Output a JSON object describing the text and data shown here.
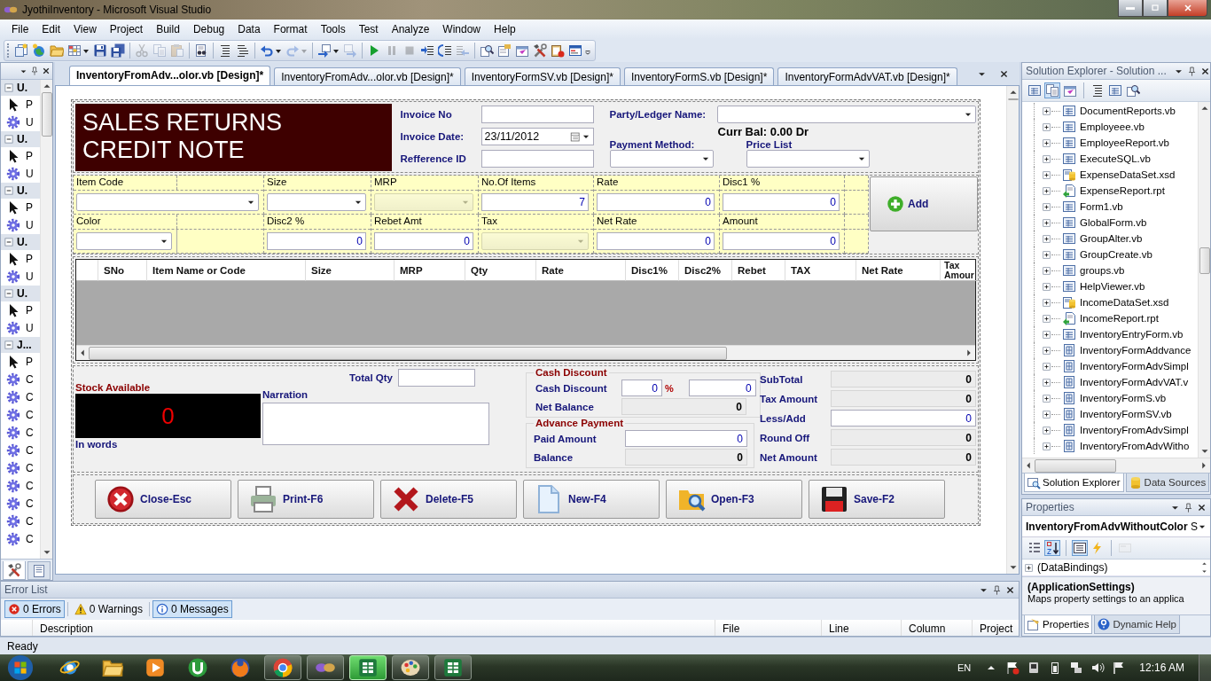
{
  "window": {
    "title": "JyothiInventory - Microsoft Visual Studio"
  },
  "menu": [
    "File",
    "Edit",
    "View",
    "Project",
    "Build",
    "Debug",
    "Data",
    "Format",
    "Tools",
    "Test",
    "Analyze",
    "Window",
    "Help"
  ],
  "toolbar": {
    "groups": [
      [
        {
          "kind": "new-project",
          "disabled": false,
          "dropdown": false
        },
        {
          "kind": "add-web",
          "disabled": false,
          "dropdown": false
        },
        {
          "kind": "open",
          "disabled": false,
          "dropdown": false
        },
        {
          "kind": "add-item",
          "disabled": false,
          "dropdown": true
        },
        {
          "kind": "save",
          "disabled": false,
          "dropdown": false
        },
        {
          "kind": "save-all",
          "disabled": false,
          "dropdown": false
        }
      ],
      [
        {
          "kind": "cut",
          "disabled": true,
          "dropdown": false
        },
        {
          "kind": "copy",
          "disabled": true,
          "dropdown": false
        },
        {
          "kind": "paste",
          "disabled": true,
          "dropdown": false
        }
      ],
      [
        {
          "kind": "find",
          "disabled": false,
          "dropdown": false
        }
      ],
      [
        {
          "kind": "comment",
          "disabled": false,
          "dropdown": false
        },
        {
          "kind": "uncomment",
          "disabled": false,
          "dropdown": false
        }
      ],
      [
        {
          "kind": "undo",
          "disabled": false,
          "dropdown": true
        },
        {
          "kind": "redo",
          "disabled": true,
          "dropdown": true
        }
      ],
      [
        {
          "kind": "navigate-back",
          "disabled": false,
          "dropdown": true
        },
        {
          "kind": "navigate-forward",
          "disabled": true,
          "dropdown": false
        }
      ],
      [
        {
          "kind": "start",
          "disabled": false,
          "dropdown": false
        },
        {
          "kind": "pause",
          "disabled": true,
          "dropdown": false
        },
        {
          "kind": "stop",
          "disabled": true,
          "dropdown": false
        },
        {
          "kind": "step-into",
          "disabled": false,
          "dropdown": false
        },
        {
          "kind": "step-over",
          "disabled": false,
          "dropdown": false
        },
        {
          "kind": "step-out",
          "disabled": true,
          "dropdown": false
        }
      ],
      [
        {
          "kind": "find-in-files",
          "disabled": false,
          "dropdown": false
        },
        {
          "kind": "properties",
          "disabled": false,
          "dropdown": false
        },
        {
          "kind": "object-browser",
          "disabled": false,
          "dropdown": false
        },
        {
          "kind": "toolbox",
          "disabled": false,
          "dropdown": false
        },
        {
          "kind": "error-list",
          "disabled": false,
          "dropdown": false
        },
        {
          "kind": "output",
          "disabled": false,
          "dropdown": false
        }
      ]
    ]
  },
  "toolbox": {
    "groups": [
      {
        "title": "U.",
        "expanded": true,
        "items": [
          {
            "kind": "pointer",
            "label": "P"
          },
          {
            "kind": "component",
            "label": "U"
          }
        ]
      },
      {
        "title": "U.",
        "expanded": true,
        "items": [
          {
            "kind": "pointer",
            "label": "P"
          },
          {
            "kind": "component",
            "label": "U"
          }
        ]
      },
      {
        "title": "U.",
        "expanded": true,
        "items": [
          {
            "kind": "pointer",
            "label": "P"
          },
          {
            "kind": "component",
            "label": "U"
          }
        ]
      },
      {
        "title": "U.",
        "expanded": true,
        "items": [
          {
            "kind": "pointer",
            "label": "P"
          },
          {
            "kind": "component",
            "label": "U"
          }
        ]
      },
      {
        "title": "U.",
        "expanded": true,
        "items": [
          {
            "kind": "pointer",
            "label": "P"
          },
          {
            "kind": "component",
            "label": "U"
          }
        ]
      },
      {
        "title": "J...",
        "expanded": true,
        "items": [
          {
            "kind": "pointer",
            "label": "P"
          },
          {
            "kind": "component",
            "label": "C"
          },
          {
            "kind": "component",
            "label": "C"
          },
          {
            "kind": "component",
            "label": "C"
          },
          {
            "kind": "component",
            "label": "C"
          },
          {
            "kind": "component",
            "label": "C"
          },
          {
            "kind": "component",
            "label": "C"
          },
          {
            "kind": "component",
            "label": "C"
          },
          {
            "kind": "component",
            "label": "C"
          },
          {
            "kind": "component",
            "label": "C"
          },
          {
            "kind": "component",
            "label": "C"
          }
        ]
      }
    ],
    "tabs": [
      {
        "kind": "toolbox",
        "selected": true
      },
      {
        "kind": "server",
        "selected": false
      }
    ]
  },
  "document_tabs": [
    {
      "label": "InventoryFromAdv...olor.vb [Design]*",
      "selected": true
    },
    {
      "label": "InventoryFromAdv...olor.vb [Design]*",
      "selected": false
    },
    {
      "label": "InventoryFormSV.vb [Design]*",
      "selected": false
    },
    {
      "label": "InventoryFormS.vb [Design]*",
      "selected": false
    },
    {
      "label": "InventoryFormAdvVAT.vb [Design]*",
      "selected": false
    }
  ],
  "form": {
    "title_lines": [
      "SALES RETURNS",
      "CREDIT NOTE"
    ],
    "header_fields": [
      {
        "label": "Invoice No",
        "kind": "text"
      },
      {
        "label": "Invoice Date:",
        "kind": "date",
        "value": "23/11/2012"
      },
      {
        "label": "Refference ID",
        "kind": "text"
      }
    ],
    "party": {
      "label": "Party/Ledger Name:",
      "kind": "combo"
    },
    "balance": "Curr Bal: 0.00 Dr",
    "selectors": [
      {
        "label": "Payment Method:",
        "kind": "combo"
      },
      {
        "label": "Price List",
        "kind": "combo"
      }
    ],
    "entry_rows": [
      [
        {
          "label": "Item Code",
          "kind": "combo",
          "disabled": false,
          "wide": true
        },
        {
          "label": "Size",
          "kind": "combo",
          "disabled": false,
          "wide": false
        },
        {
          "label": "MRP",
          "kind": "combo",
          "disabled": true,
          "wide": false
        },
        {
          "label": "No.Of Items",
          "kind": "number",
          "value": "7",
          "disabled": false,
          "wide": false
        },
        {
          "label": "Rate",
          "kind": "number",
          "value": "0",
          "disabled": false,
          "wide": false
        },
        {
          "label": "Disc1 %",
          "kind": "number",
          "value": "0",
          "disabled": false,
          "wide": false
        }
      ],
      [
        {
          "label": "Color",
          "kind": "combo",
          "disabled": false,
          "wide": false
        },
        {
          "label": "Disc2 %",
          "kind": "number",
          "value": "0",
          "disabled": false,
          "wide": false
        },
        {
          "label": "Rebet Amt",
          "kind": "number",
          "value": "0",
          "disabled": false,
          "wide": false
        },
        {
          "label": "Tax",
          "kind": "combo",
          "disabled": true,
          "wide": false
        },
        {
          "label": "Net Rate",
          "kind": "number",
          "value": "0",
          "disabled": false,
          "wide": false
        },
        {
          "label": "Amount",
          "kind": "number",
          "value": "0",
          "disabled": false,
          "wide": false
        }
      ]
    ],
    "add_button": "Add",
    "grid": {
      "columns": [
        "SNo",
        "Item Name or Code",
        "Size",
        "MRP",
        "Qty",
        "Rate",
        "Disc1%",
        "Disc2%",
        "Rebet",
        "TAX",
        "Net Rate",
        "Tax Amour"
      ]
    },
    "summary": {
      "total_qty_label": "Total Qty",
      "stock_label": "Stock Available",
      "stock_value": "0",
      "words_label": "In words",
      "narration_label": "Narration",
      "cash_discount": {
        "title": "Cash Discount",
        "label": "Cash Discount",
        "percent": "0",
        "unit": "%",
        "value": "0",
        "net_label": "Net Balance",
        "net": "0"
      },
      "advance": {
        "title": "Advance Payment",
        "rows": [
          {
            "label": "Paid Amount",
            "kind": "input",
            "value": "0"
          },
          {
            "label": "Balance",
            "kind": "readonly",
            "value": "0"
          }
        ]
      },
      "totals": [
        {
          "label": "SubTotal",
          "kind": "readonly",
          "value": "0"
        },
        {
          "label": "Tax Amount",
          "kind": "readonly",
          "value": "0"
        },
        {
          "label": "Less/Add",
          "kind": "input",
          "value": "0"
        },
        {
          "label": "Round Off",
          "kind": "readonly",
          "value": "0"
        },
        {
          "label": "Net Amount",
          "kind": "readonly",
          "value": "0"
        }
      ]
    },
    "buttons": [
      {
        "label": "Close-Esc",
        "kind": "close"
      },
      {
        "label": "Print-F6",
        "kind": "print"
      },
      {
        "label": "Delete-F5",
        "kind": "delete"
      },
      {
        "label": "New-F4",
        "kind": "new"
      },
      {
        "label": "Open-F3",
        "kind": "open"
      },
      {
        "label": "Save-F2",
        "kind": "save"
      }
    ]
  },
  "solution_explorer": {
    "title": "Solution Explorer - Solution ...",
    "items": [
      {
        "label": "DocumentReports.vb",
        "kind": "form"
      },
      {
        "label": "Employeee.vb",
        "kind": "form"
      },
      {
        "label": "EmployeeReport.vb",
        "kind": "form"
      },
      {
        "label": "ExecuteSQL.vb",
        "kind": "form"
      },
      {
        "label": "ExpenseDataSet.xsd",
        "kind": "dataset"
      },
      {
        "label": "ExpenseReport.rpt",
        "kind": "report"
      },
      {
        "label": "Form1.vb",
        "kind": "form"
      },
      {
        "label": "GlobalForm.vb",
        "kind": "form"
      },
      {
        "label": "GroupAlter.vb",
        "kind": "form"
      },
      {
        "label": "GroupCreate.vb",
        "kind": "form"
      },
      {
        "label": "groups.vb",
        "kind": "form"
      },
      {
        "label": "HelpViewer.vb",
        "kind": "form"
      },
      {
        "label": "IncomeDataSet.xsd",
        "kind": "dataset"
      },
      {
        "label": "IncomeReport.rpt",
        "kind": "report"
      },
      {
        "label": "InventoryEntryForm.vb",
        "kind": "form"
      },
      {
        "label": "InventoryFormAddvance",
        "kind": "gridform"
      },
      {
        "label": "InventoryFormAdvSimpl",
        "kind": "gridform"
      },
      {
        "label": "InventoryFormAdvVAT.v",
        "kind": "gridform"
      },
      {
        "label": "InventoryFormS.vb",
        "kind": "gridform"
      },
      {
        "label": "InventoryFormSV.vb",
        "kind": "gridform"
      },
      {
        "label": "InventoryFromAdvSimpl",
        "kind": "gridform"
      },
      {
        "label": "InventoryFromAdvWitho",
        "kind": "gridform"
      }
    ],
    "tabs": [
      {
        "label": "Solution Explorer",
        "kind": "explorer",
        "selected": true
      },
      {
        "label": "Data Sources",
        "kind": "datasource",
        "selected": false
      }
    ]
  },
  "properties": {
    "title": "Properties",
    "object": "**InventoryFromAdvWithoutColor** S",
    "toolbar": [
      {
        "kind": "categorized",
        "selected": false,
        "disabled": false
      },
      {
        "kind": "alphabetical",
        "selected": true,
        "disabled": false
      },
      {
        "kind": "property-list",
        "selected": true,
        "disabled": false
      },
      {
        "kind": "events",
        "selected": false,
        "disabled": false
      },
      {
        "kind": "pages",
        "selected": false,
        "disabled": true
      }
    ],
    "rows": [
      {
        "label": "(DataBindings)",
        "expanded": false
      }
    ],
    "description_title": "(ApplicationSettings)",
    "description": "Maps property settings to an applica",
    "tabs": [
      {
        "label": "Properties",
        "kind": "properties",
        "selected": true
      },
      {
        "label": "Dynamic Help",
        "kind": "help",
        "selected": false
      }
    ]
  },
  "error_list": {
    "title": "Error List",
    "filters": [
      {
        "kind": "error",
        "label": "0 Errors",
        "selected": true
      },
      {
        "kind": "warning",
        "label": "0 Warnings",
        "selected": false
      },
      {
        "kind": "info",
        "label": "0 Messages",
        "selected": true
      }
    ],
    "columns": [
      "Description",
      "File",
      "Line",
      "Column",
      "Project"
    ]
  },
  "status_bar": "Ready",
  "taskbar": {
    "apps": [
      {
        "kind": "browser",
        "running": false,
        "selected": false
      },
      {
        "kind": "folder",
        "running": false,
        "selected": false
      },
      {
        "kind": "media",
        "running": false,
        "selected": false
      },
      {
        "kind": "torrent",
        "running": false,
        "selected": false
      },
      {
        "kind": "firefox",
        "running": false,
        "selected": false
      },
      {
        "kind": "chrome",
        "running": true,
        "selected": false
      },
      {
        "kind": "studio",
        "running": true,
        "selected": false
      },
      {
        "kind": "sheet",
        "running": true,
        "selected": true
      },
      {
        "kind": "paint",
        "running": true,
        "selected": false
      },
      {
        "kind": "sheet",
        "running": true,
        "selected": false
      }
    ],
    "language": "EN",
    "clock": "12:16 AM"
  }
}
